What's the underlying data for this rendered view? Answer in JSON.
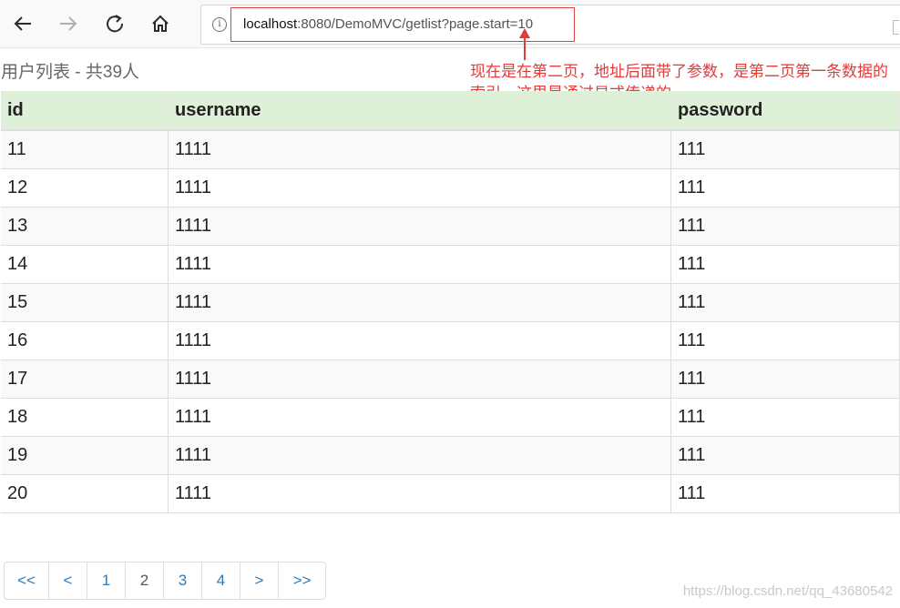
{
  "browser": {
    "url_host": "localhost",
    "url_path": ":8080/DemoMVC/getlist?page.start=10",
    "info_symbol": "i"
  },
  "page": {
    "title": "用户列表 - 共39人"
  },
  "annotation": {
    "text": "现在是在第二页，地址后面带了参数，是第二页第一条数据的索引，这里是通过显式传递的",
    "color": "#e33a3a"
  },
  "table": {
    "headers": [
      "id",
      "username",
      "password"
    ],
    "rows": [
      [
        "11",
        "1111",
        "111"
      ],
      [
        "12",
        "1111",
        "111"
      ],
      [
        "13",
        "1111",
        "111"
      ],
      [
        "14",
        "1111",
        "111"
      ],
      [
        "15",
        "1111",
        "111"
      ],
      [
        "16",
        "1111",
        "111"
      ],
      [
        "17",
        "1111",
        "111"
      ],
      [
        "18",
        "1111",
        "111"
      ],
      [
        "19",
        "1111",
        "111"
      ],
      [
        "20",
        "1111",
        "111"
      ]
    ]
  },
  "pagination": [
    {
      "label": "<<",
      "width": 48
    },
    {
      "label": "<",
      "width": 41
    },
    {
      "label": "1",
      "width": 41
    },
    {
      "label": "2",
      "width": 41,
      "current": true
    },
    {
      "label": "3",
      "width": 41
    },
    {
      "label": "4",
      "width": 41
    },
    {
      "label": ">",
      "width": 41
    },
    {
      "label": ">>",
      "width": 51
    }
  ],
  "watermark": "https://blog.csdn.net/qq_43680542"
}
